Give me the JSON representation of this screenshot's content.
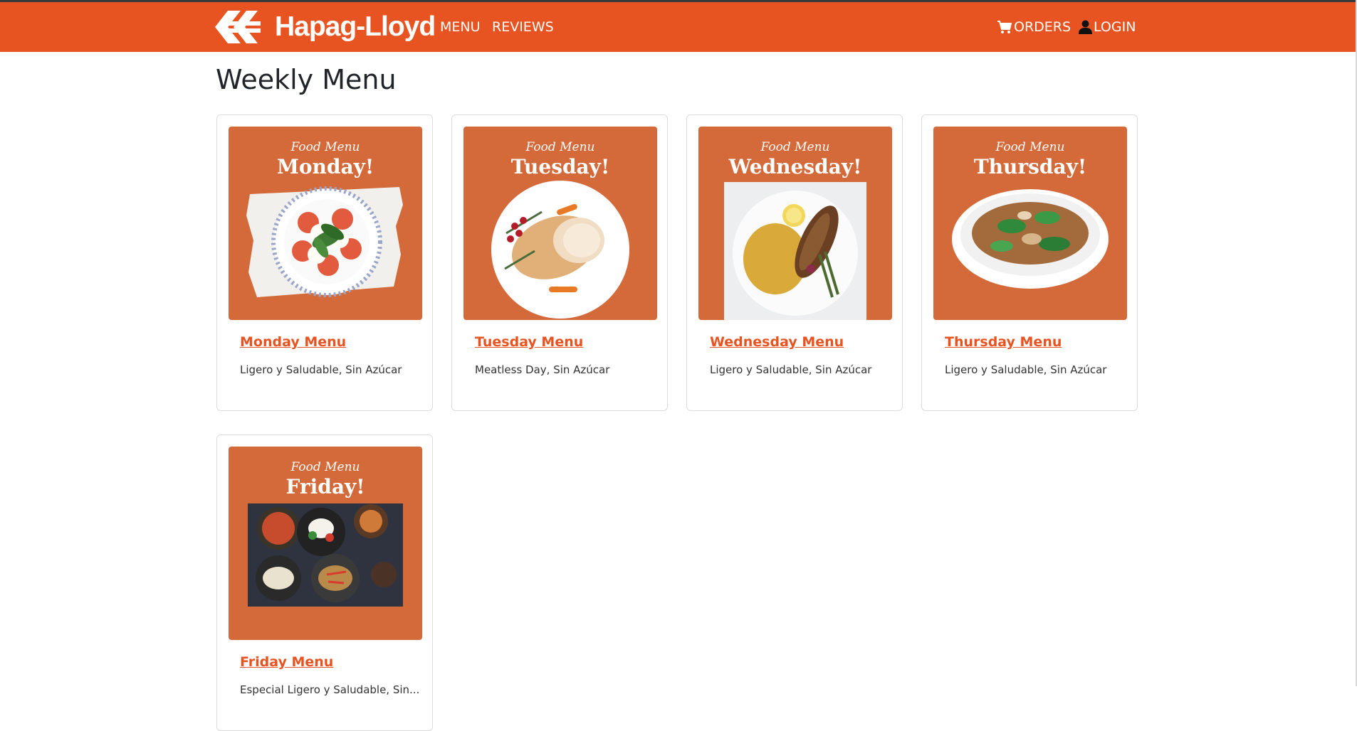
{
  "navbar": {
    "brand": "Hapag-Lloyd",
    "links": [
      "MENU",
      "REVIEWS"
    ],
    "orders_label": "ORDERS",
    "login_label": "LOGIN",
    "background_color": "#e85421"
  },
  "page": {
    "title": "Weekly Menu"
  },
  "menus": [
    {
      "script": "Food Menu",
      "day": "Monday!",
      "link": "Monday Menu",
      "description": "Ligero y Saludable, Sin Azúcar"
    },
    {
      "script": "Food Menu",
      "day": "Tuesday!",
      "link": "Tuesday Menu",
      "description": "Meatless Day, Sin Azúcar"
    },
    {
      "script": "Food Menu",
      "day": "Wednesday!",
      "link": "Wednesday Menu",
      "description": "Ligero y Saludable, Sin Azúcar"
    },
    {
      "script": "Food Menu",
      "day": "Thursday!",
      "link": "Thursday Menu",
      "description": "Ligero y Saludable, Sin Azúcar"
    },
    {
      "script": "Food Menu",
      "day": "Friday!",
      "link": "Friday Menu",
      "description": "Especial Ligero y Saludable, Sin..."
    }
  ],
  "colors": {
    "accent": "#e85421",
    "card_image_bg": "#d4693a"
  }
}
